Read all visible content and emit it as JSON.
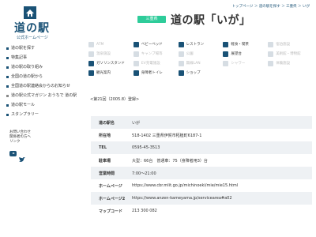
{
  "breadcrumb": "トップページ ＞ 道の駅を探す ＞ 三重県 ＞ いが",
  "logo": {
    "title": "道の駅",
    "subtitle": "公式ホームページ"
  },
  "nav": [
    {
      "label": "道の駅を探す",
      "sub": false
    },
    {
      "label": "特集記事",
      "sub": false
    },
    {
      "label": "道の駅の取り組み",
      "sub": false
    },
    {
      "label": "全国の道の駅から",
      "sub": false
    },
    {
      "label": "全国道の駅連絡会からのお知らせ",
      "sub": false
    },
    {
      "label": "道の駅公式マガジン おうちで 道の駅",
      "sub": true
    },
    {
      "label": "道の駅モール",
      "sub": false
    },
    {
      "label": "スタンプラリー",
      "sub": false
    }
  ],
  "contact": [
    "お問い合わせ",
    "関係者の方へ",
    "リンク"
  ],
  "header": {
    "prefecture": "三重県",
    "title": "道の駅「いが」"
  },
  "facilities": [
    {
      "label": "ATM",
      "available": false,
      "icon": "atm-icon"
    },
    {
      "label": "ベビーベッド",
      "available": true,
      "icon": "baby-bed-icon"
    },
    {
      "label": "レストラン",
      "available": true,
      "icon": "restaurant-icon"
    },
    {
      "label": "軽食・喫茶",
      "available": true,
      "icon": "cafe-icon"
    },
    {
      "label": "宿泊施設",
      "available": false,
      "icon": "hotel-icon"
    },
    {
      "label": "温泉施設",
      "available": false,
      "icon": "hot-spring-icon"
    },
    {
      "label": "キャンプ場等",
      "available": false,
      "icon": "camp-icon"
    },
    {
      "label": "公園",
      "available": false,
      "icon": "park-icon"
    },
    {
      "label": "展望台",
      "available": true,
      "icon": "observatory-icon"
    },
    {
      "label": "美術館・博物館",
      "available": false,
      "icon": "museum-icon"
    },
    {
      "label": "ガソリンスタンド",
      "available": true,
      "icon": "gas-station-icon"
    },
    {
      "label": "EV充電施設",
      "available": false,
      "icon": "ev-charger-icon"
    },
    {
      "label": "無線LAN",
      "available": false,
      "icon": "wifi-icon"
    },
    {
      "label": "シャワー",
      "available": false,
      "icon": "shower-icon"
    },
    {
      "label": "体験施設",
      "available": false,
      "icon": "experience-icon"
    },
    {
      "label": "観光案内",
      "available": true,
      "icon": "tourist-info-icon"
    },
    {
      "label": "身障者トイレ",
      "available": true,
      "icon": "accessible-toilet-icon"
    },
    {
      "label": "ショップ",
      "available": true,
      "icon": "shop-icon"
    }
  ],
  "registration": "<第21回（2005.8）登録>",
  "info": [
    {
      "label": "道の駅名",
      "value": "いが"
    },
    {
      "label": "所在地",
      "value": "518-1402 三重県伊賀市柘植町6187-1"
    },
    {
      "label": "TEL",
      "value": "0595-45-3513"
    },
    {
      "label": "駐車場",
      "value": "大型：66台　普通車：75（身障者用3）台"
    },
    {
      "label": "営業時間",
      "value": "7:00〜21:00"
    },
    {
      "label": "ホームページ",
      "value": "https://www.cbr.mlit.go.jp/michinoeki/mie/mie15.html"
    },
    {
      "label": "ホームページ2",
      "value": "https://www.anzen-kameyama.jp/servicearea#a02"
    },
    {
      "label": "マップコード",
      "value": "213 300 082"
    }
  ],
  "colors": {
    "brand": "#1a5276",
    "badge": "#2ecc9a",
    "row_alt": "#eef1f4",
    "inactive": "#bbbbbb"
  }
}
